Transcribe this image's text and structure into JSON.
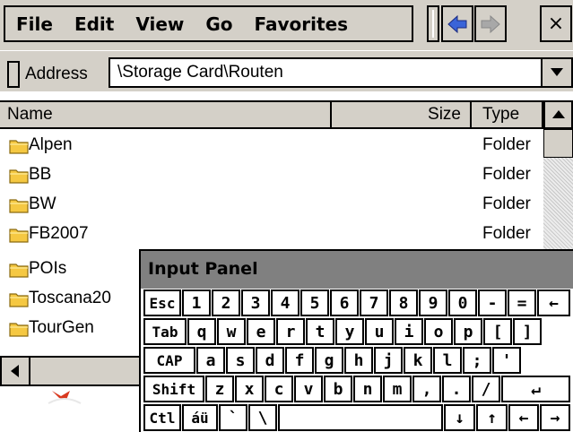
{
  "menu": {
    "items": [
      "File",
      "Edit",
      "View",
      "Go",
      "Favorites"
    ],
    "close_label": "×"
  },
  "address": {
    "label": "Address",
    "value": "\\Storage Card\\Routen"
  },
  "columns": {
    "name": "Name",
    "size": "Size",
    "type": "Type"
  },
  "rows": [
    {
      "name": "Alpen",
      "type": "Folder"
    },
    {
      "name": "BB",
      "type": "Folder"
    },
    {
      "name": "BW",
      "type": "Folder"
    },
    {
      "name": "FB2007",
      "type": "Folder"
    },
    {
      "name": "POIs",
      "type": ""
    },
    {
      "name": "Toscana20",
      "type": ""
    },
    {
      "name": "TourGen",
      "type": ""
    }
  ],
  "input_panel": {
    "title": "Input Panel",
    "rows": [
      [
        "Esc",
        "1",
        "2",
        "3",
        "4",
        "5",
        "6",
        "7",
        "8",
        "9",
        "0",
        "-",
        "=",
        "←"
      ],
      [
        "Tab",
        "q",
        "w",
        "e",
        "r",
        "t",
        "y",
        "u",
        "i",
        "o",
        "p",
        "[",
        "]"
      ],
      [
        "CAP",
        "a",
        "s",
        "d",
        "f",
        "g",
        "h",
        "j",
        "k",
        "l",
        ";",
        "'"
      ],
      [
        "Shift",
        "z",
        "x",
        "c",
        "v",
        "b",
        "n",
        "m",
        ",",
        ".",
        "/",
        "↵"
      ],
      [
        "Ctl",
        "áü",
        "`",
        "\\",
        "",
        "↓",
        "↑",
        "←",
        "→"
      ]
    ]
  },
  "colors": {
    "chrome": "#d4d0c8",
    "panel_title": "#808080",
    "back_arrow": "#3a64d8",
    "folder": "#f5c842"
  }
}
